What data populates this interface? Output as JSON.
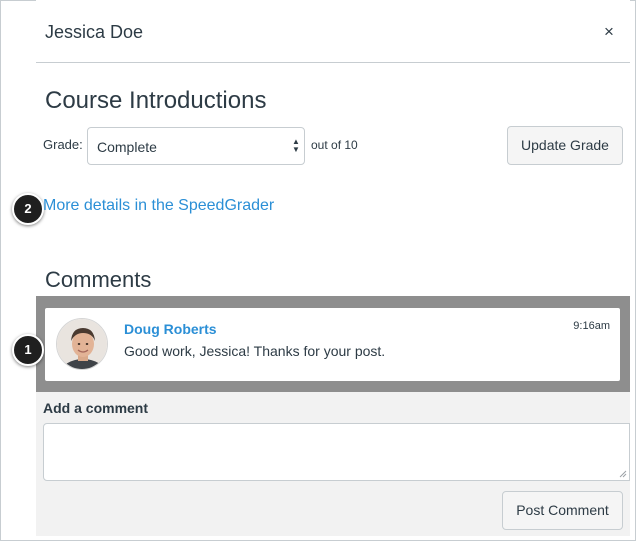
{
  "header": {
    "student_name": "Jessica Doe",
    "close_label": "×"
  },
  "assignment": {
    "title": "Course Introductions"
  },
  "grade": {
    "label": "Grade:",
    "selected_value": "Complete",
    "out_of_text": "out of 10",
    "update_button_label": "Update Grade"
  },
  "speedgrader": {
    "link_text": "More details in the SpeedGrader"
  },
  "callouts": {
    "one": "1",
    "two": "2"
  },
  "comments": {
    "heading": "Comments",
    "items": [
      {
        "author": "Doug Roberts",
        "time": "9:16am",
        "body": "Good work, Jessica! Thanks for your post."
      }
    ]
  },
  "add_comment": {
    "label": "Add a comment",
    "placeholder": "",
    "post_button_label": "Post Comment"
  },
  "colors": {
    "link": "#2b8fd6",
    "text": "#2d3b45",
    "highlight": "#8e8e8e",
    "border": "#c7cdd1"
  },
  "icons": {
    "close": "close-icon",
    "select_arrows": "updown-arrows-icon",
    "avatar": "user-avatar"
  }
}
